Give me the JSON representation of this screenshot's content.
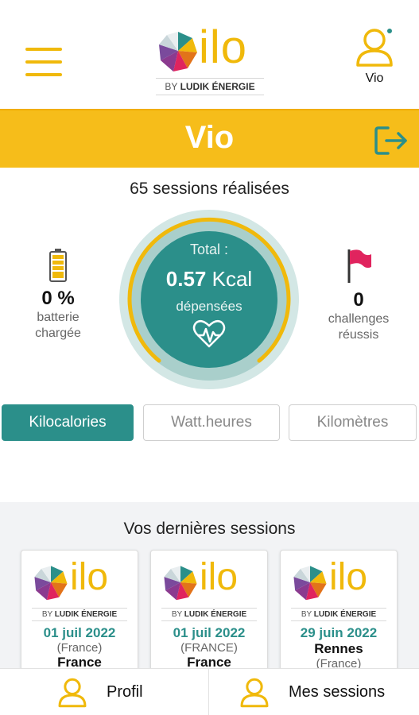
{
  "header": {
    "logo_word": "ilo",
    "logo_by": "BY",
    "logo_brand": "LUDIK ÉNERGIE",
    "user_name": "Vio"
  },
  "banner": {
    "title": "Vio"
  },
  "sessions_count": "65 sessions réalisées",
  "stats": {
    "battery": {
      "value": "0 %",
      "label_line1": "batterie",
      "label_line2": "chargée"
    },
    "challenges": {
      "value": "0",
      "label_line1": "challenges",
      "label_line2": "réussis"
    }
  },
  "gauge": {
    "label": "Total :",
    "value": "0.57",
    "unit": "Kcal",
    "suffix": "dépensées"
  },
  "tabs": [
    {
      "label": "Kilocalories",
      "active": true
    },
    {
      "label": "Watt.heures",
      "active": false
    },
    {
      "label": "Kilomètres",
      "active": false
    }
  ],
  "recent": {
    "title": "Vos dernières sessions",
    "cards": [
      {
        "date": "01 juil 2022",
        "country": "(France)",
        "city": "France"
      },
      {
        "date": "01 juil 2022",
        "country": "(FRANCE)",
        "city": "France"
      },
      {
        "date": "29 juin 2022",
        "city": "Rennes",
        "country": "(France)"
      }
    ]
  },
  "bottom_nav": {
    "profile": "Profil",
    "sessions": "Mes sessions"
  },
  "colors": {
    "accent_yellow": "#f6bd1a",
    "teal": "#2b8f8a",
    "pink_flag": "#e0245e"
  }
}
